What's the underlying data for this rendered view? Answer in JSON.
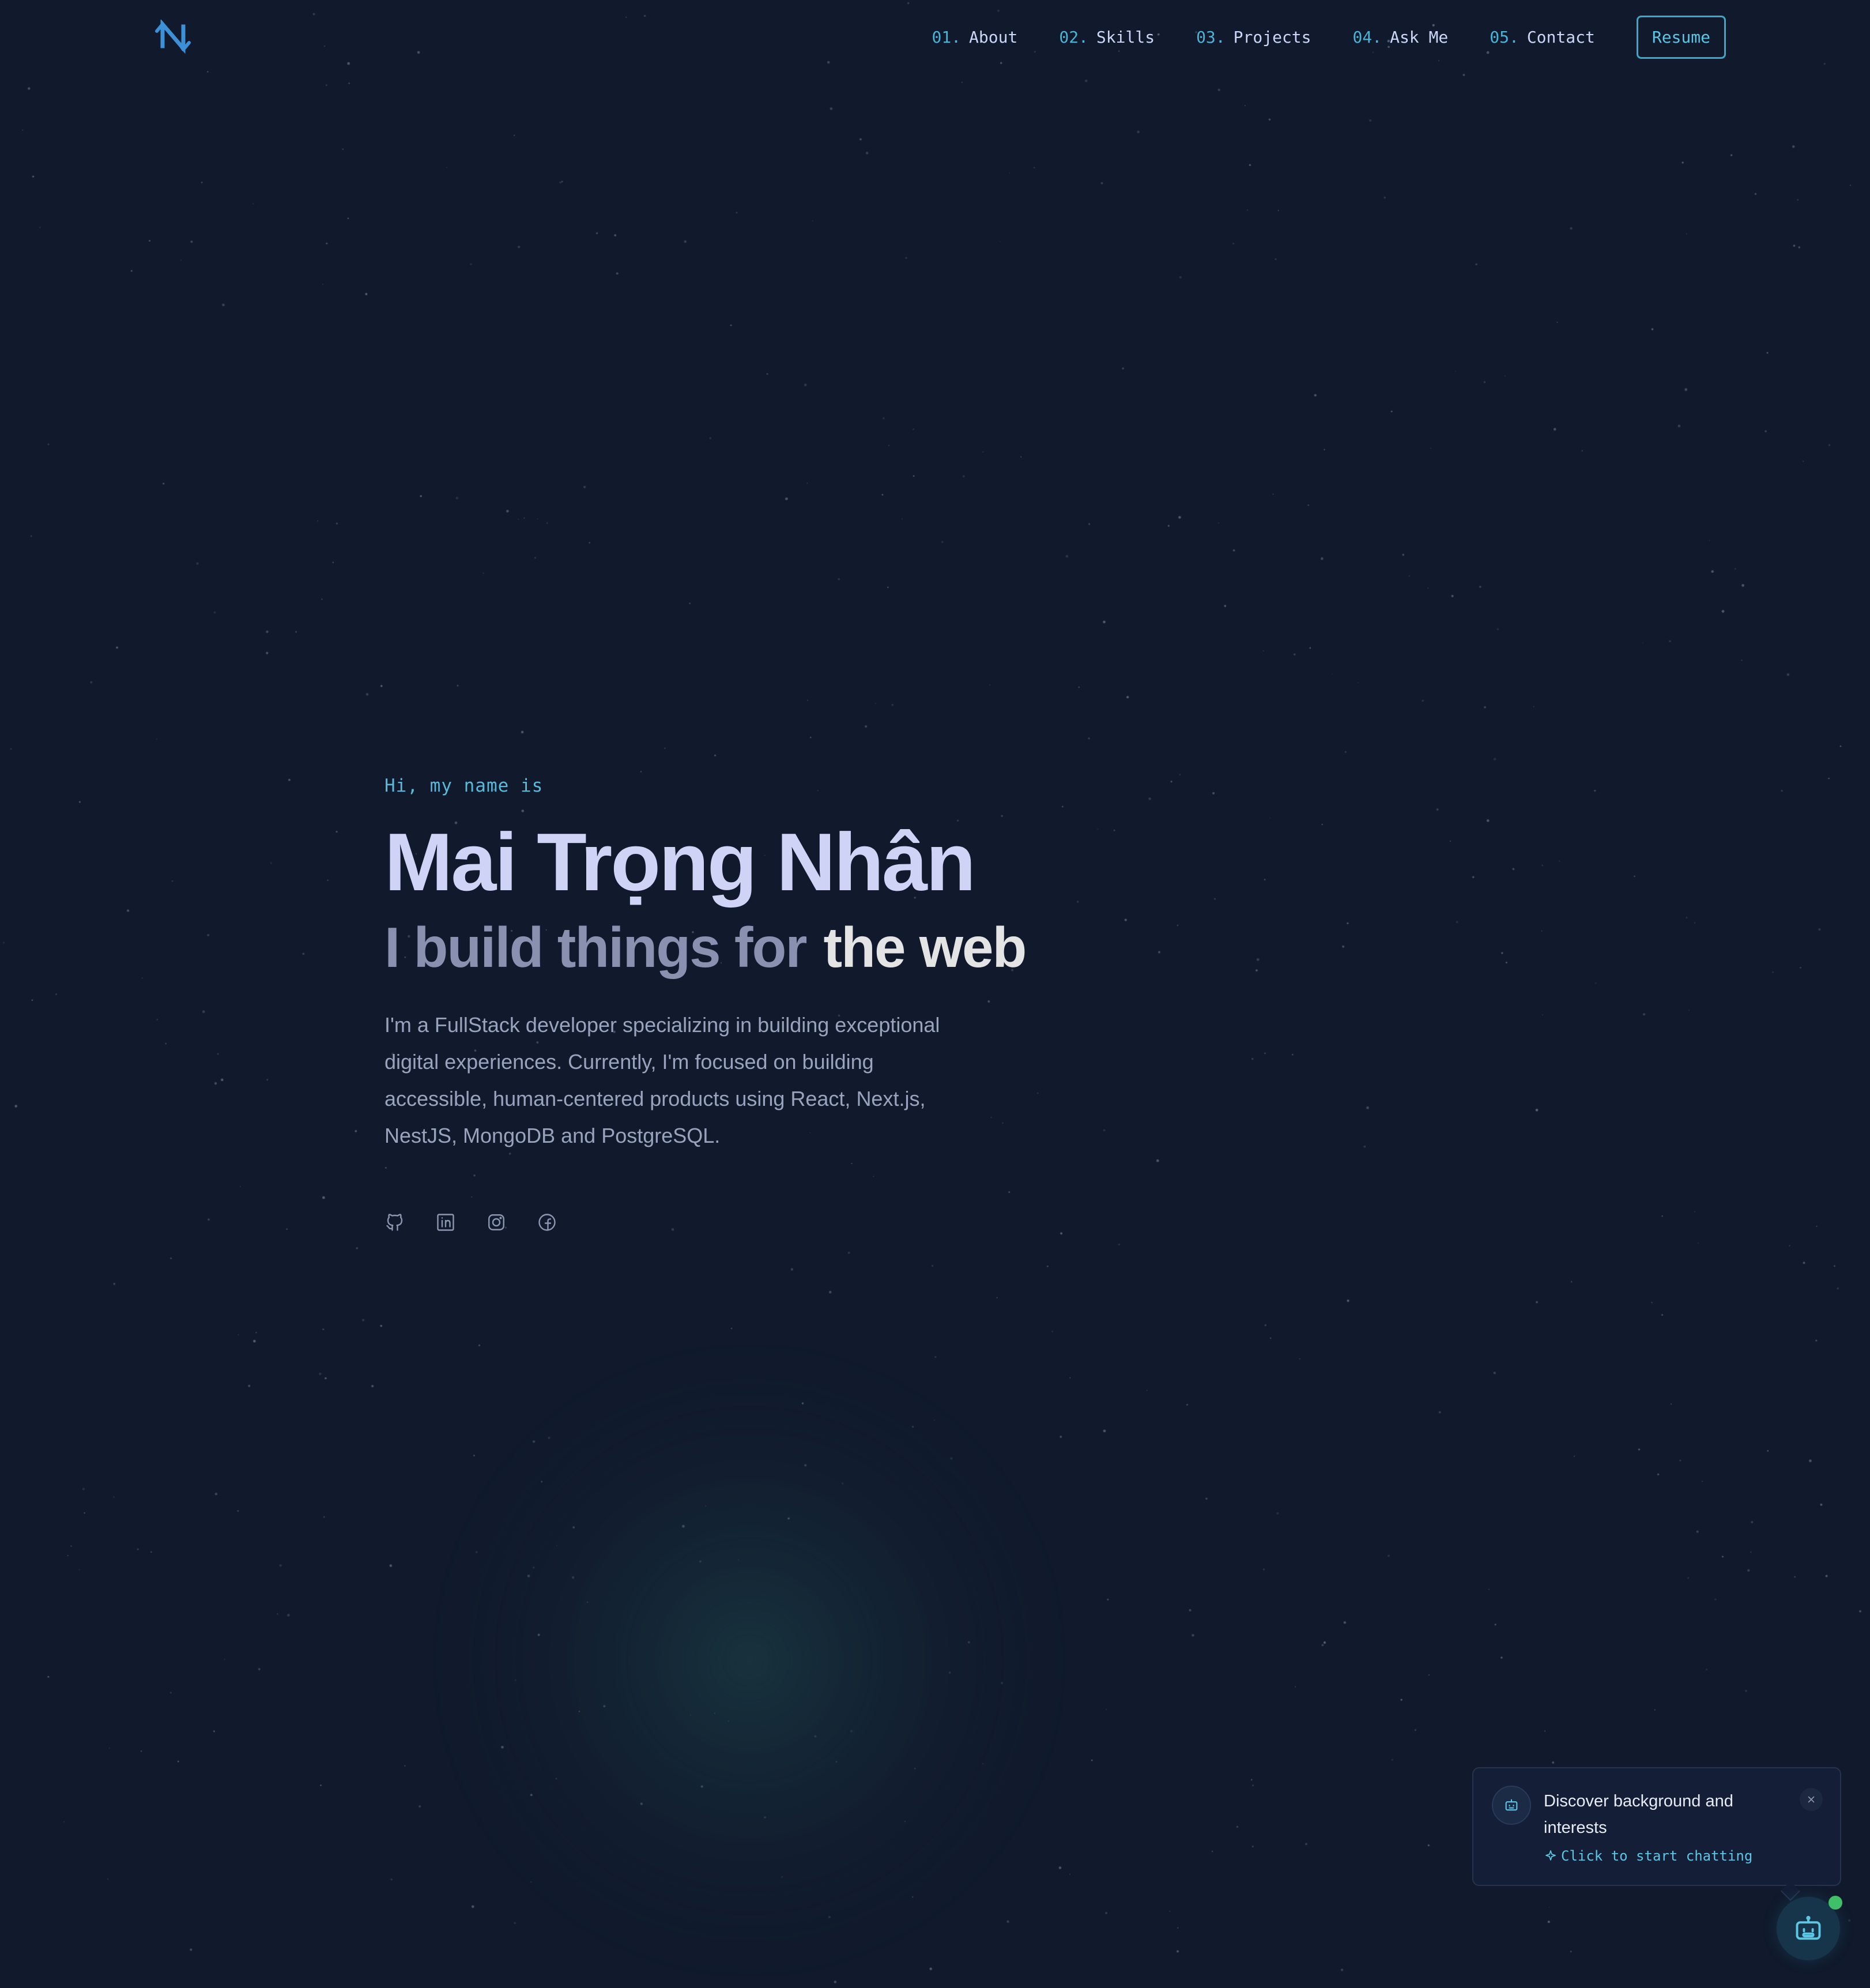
{
  "nav": {
    "items": [
      {
        "num": "01.",
        "label": "About"
      },
      {
        "num": "02.",
        "label": "Skills"
      },
      {
        "num": "03.",
        "label": "Projects"
      },
      {
        "num": "04.",
        "label": "Ask Me"
      },
      {
        "num": "05.",
        "label": "Contact"
      }
    ],
    "resume_label": "Resume",
    "logo_icon": "n-monogram-logo"
  },
  "hero": {
    "greeting": "Hi, my name is",
    "name": "Mai Trọng Nhân",
    "tagline_part1": "I build things for",
    "tagline_part2": "the web",
    "description": "I'm a FullStack developer specializing in building exceptional digital experiences. Currently, I'm focused on building accessible, human-centered products using React, Next.js, NestJS, MongoDB and PostgreSQL.",
    "socials": [
      "github-icon",
      "linkedin-icon",
      "instagram-icon",
      "facebook-icon"
    ]
  },
  "chat": {
    "title": "Discover background and interests",
    "cta": "Click to start chatting",
    "status": "online"
  },
  "colors": {
    "background": "#101a2c",
    "accent": "#5cc6e4",
    "name": "#cfd4f7",
    "text_muted": "#9aa3bd",
    "online": "#3fbf67"
  }
}
